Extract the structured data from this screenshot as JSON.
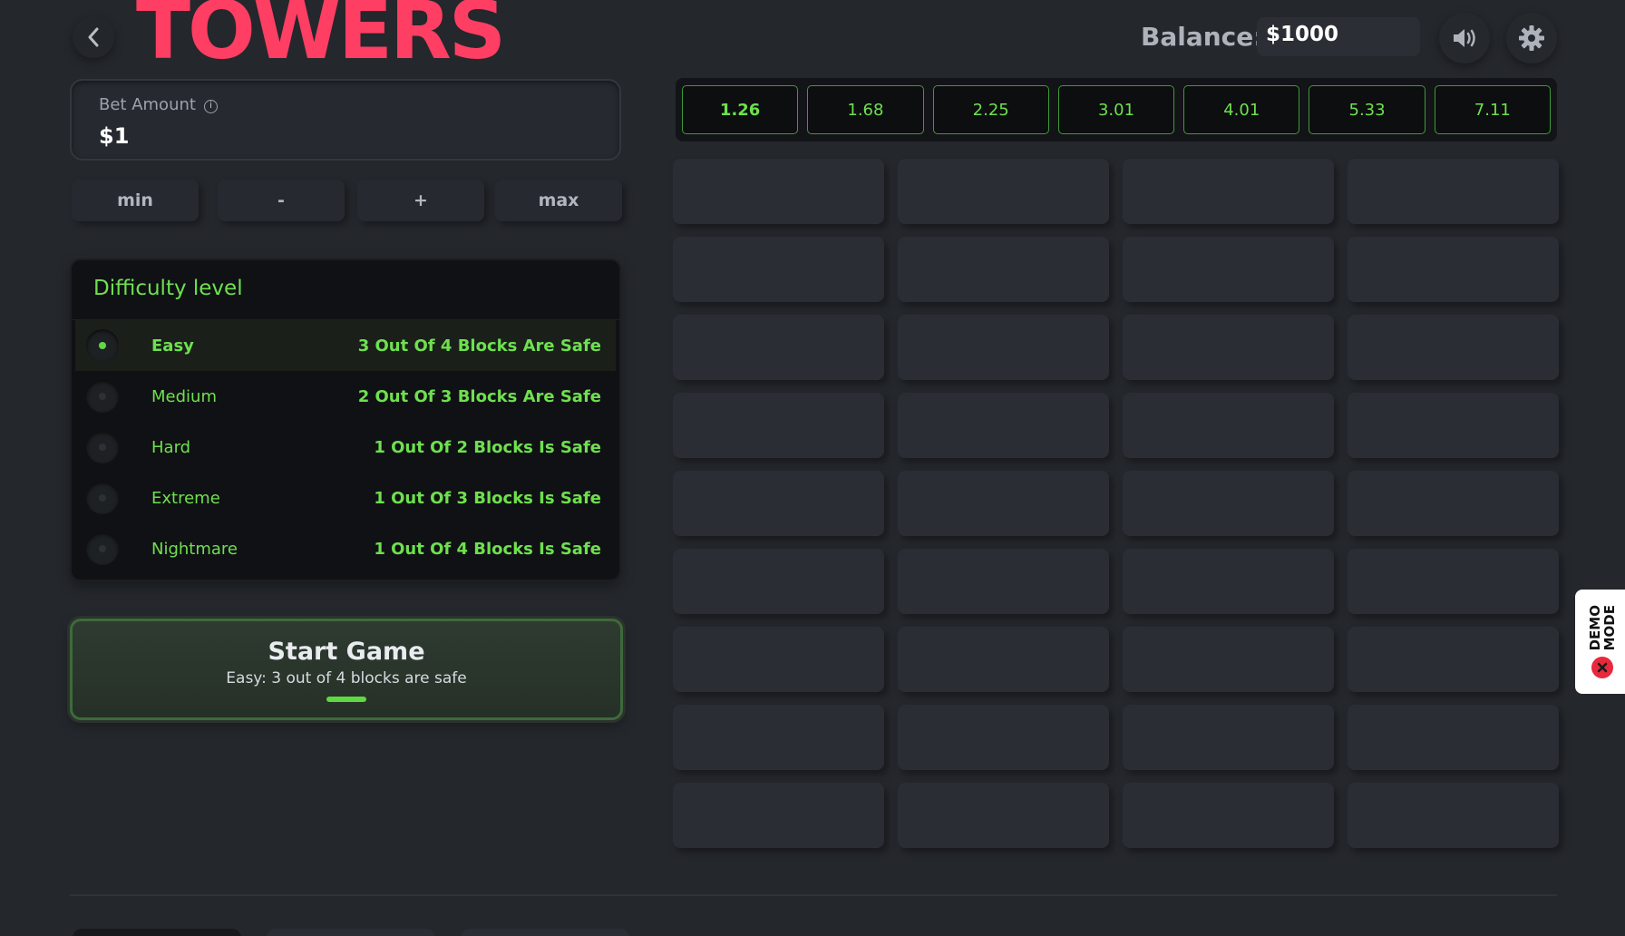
{
  "header": {
    "logo_text": "TOWERS",
    "balance_label": "Balance:",
    "balance_value": "$1000"
  },
  "bet": {
    "label": "Bet Amount",
    "value": "$1",
    "buttons": [
      "min",
      "-",
      "+",
      "max"
    ]
  },
  "difficulty": {
    "title": "Difficulty level",
    "selected": "Easy",
    "levels": [
      {
        "name": "Easy",
        "desc": "3 Out Of 4 Blocks Are Safe"
      },
      {
        "name": "Medium",
        "desc": "2 Out Of 3 Blocks Are Safe"
      },
      {
        "name": "Hard",
        "desc": "1 Out Of 2 Blocks Is Safe"
      },
      {
        "name": "Extreme",
        "desc": "1 Out Of 3 Blocks Is Safe"
      },
      {
        "name": "Nightmare",
        "desc": "1 Out Of 4 Blocks Is Safe"
      }
    ]
  },
  "start": {
    "title": "Start Game",
    "subtitle": "Easy: 3 out of 4 blocks are safe"
  },
  "multipliers": [
    "1.26",
    "1.68",
    "2.25",
    "3.01",
    "4.01",
    "5.33",
    "7.11"
  ],
  "grid": {
    "rows": 9,
    "cols": 4
  },
  "demo_badge": {
    "line1": "DEMO",
    "line2": "MODE"
  },
  "colors": {
    "logo": "#ff3e63",
    "accent_green": "#6ee04f",
    "background": "#24272c",
    "demo_x": "#e8283c"
  },
  "icons": [
    "chevron-left-icon",
    "speaker-icon",
    "gear-icon",
    "info-icon",
    "close-icon"
  ]
}
